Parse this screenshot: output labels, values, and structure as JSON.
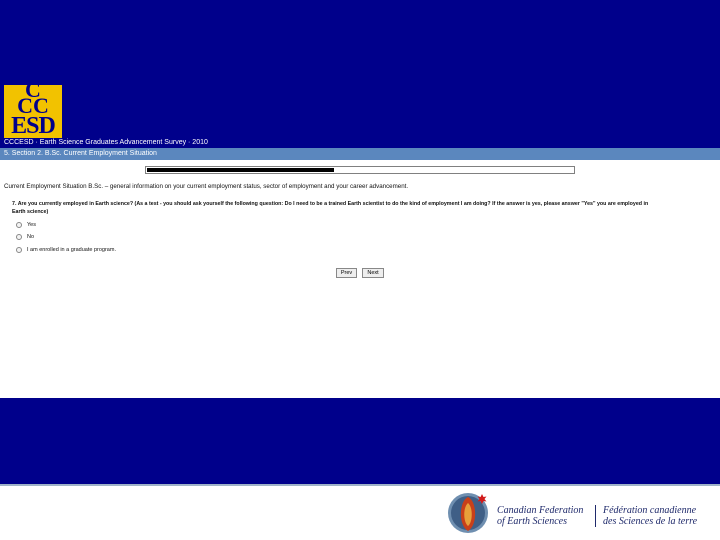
{
  "header": {
    "logo_line1": "C",
    "logo_line2": "CC",
    "logo_line3": "ESD",
    "survey_title": "CCCESD · Earth Science Graduates Advancement Survey · 2010",
    "section_title": "5. Section 2. B.Sc. Current Employment Situation"
  },
  "progress": {
    "fraction": 0.44
  },
  "main": {
    "intro": "Current Employment Situation B.Sc. – general information on your current employment status, sector of employment and your career advancement.",
    "question_line1": "7. Are you currently employed in Earth science? (As a test - you should ask yourself the following question: Do I need to be a trained Earth scientist to do the kind of employment I am doing? If the answer is yes, please answer \"Yes\" you are employed in",
    "question_line2": "Earth science)",
    "options": [
      "Yes",
      "No",
      "I am enrolled in a graduate program."
    ]
  },
  "buttons": {
    "prev": "Prev",
    "next": "Next"
  },
  "footer": {
    "en_line1": "Canadian Federation",
    "en_line2": "of Earth Sciences",
    "fr_line1": "Fédération canadienne",
    "fr_line2": "des Sciences de la terre"
  },
  "colors": {
    "band": "#00008b",
    "logo_bg": "#f2c200",
    "section_bar": "#5b87be",
    "footer_text": "#1f2a6b"
  },
  "icons": {
    "emblem": "cfes-emblem-icon",
    "radio": "radio-button-icon"
  }
}
